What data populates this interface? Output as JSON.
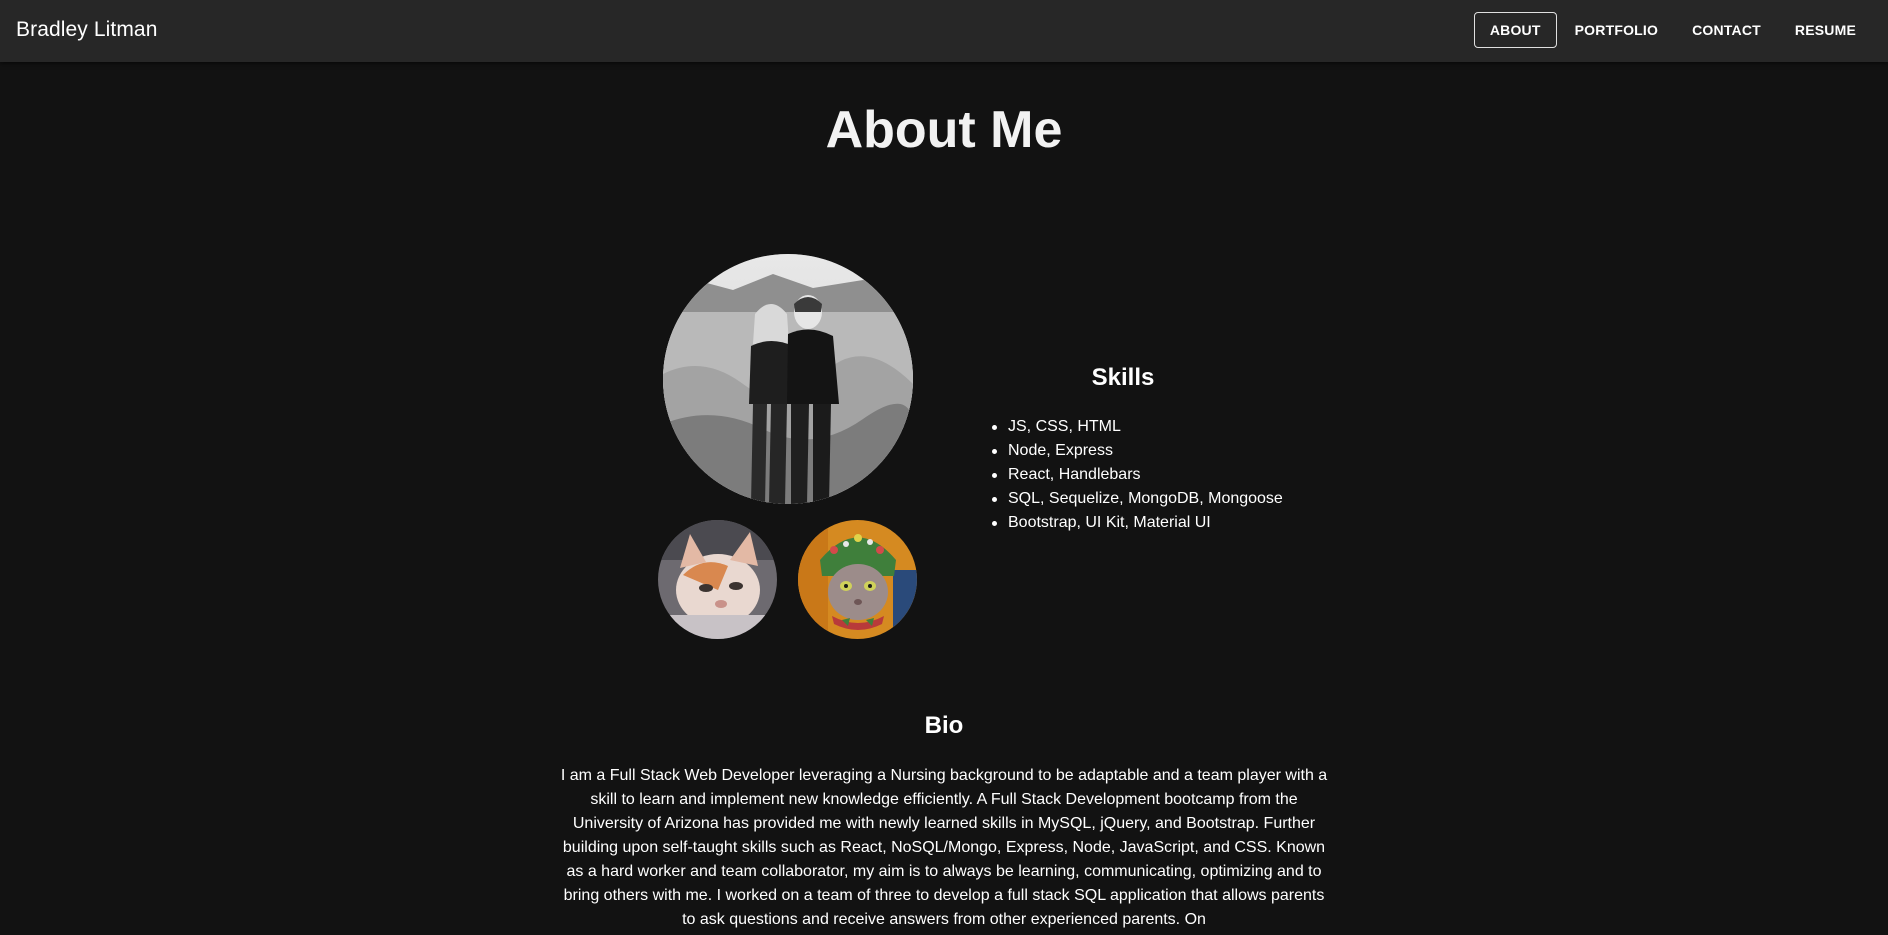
{
  "nav": {
    "brand": "Bradley Litman",
    "links": [
      "ABOUT",
      "PORTFOLIO",
      "CONTACT",
      "RESUME"
    ],
    "active": "ABOUT"
  },
  "main": {
    "title": "About Me"
  },
  "photos": {
    "main": "black-and-white couple portrait",
    "pets": [
      "cat photo",
      "cat wearing hat photo"
    ]
  },
  "skills": {
    "title": "Skills",
    "items": [
      "JS, CSS, HTML",
      "Node, Express",
      "React, Handlebars",
      "SQL, Sequelize, MongoDB, Mongoose",
      "Bootstrap, UI Kit, Material UI"
    ]
  },
  "bio": {
    "title": "Bio",
    "text": "I am a Full Stack Web Developer leveraging a Nursing background to be adaptable and a team player with a skill to learn and implement new knowledge efficiently. A Full Stack Development bootcamp from the University of Arizona has provided me with newly learned skills in MySQL, jQuery, and Bootstrap. Further building upon self-taught skills such as React, NoSQL/Mongo, Express, Node, JavaScript, and CSS. Known as a hard worker and team collaborator, my aim is to always be learning, communicating, optimizing and to bring others with me. I worked on a team of three to develop a full stack SQL application that allows parents to ask questions and receive answers from other experienced parents. On"
  },
  "colors": {
    "background": "#121212",
    "navbar": "#272727",
    "text": "#ffffff"
  }
}
